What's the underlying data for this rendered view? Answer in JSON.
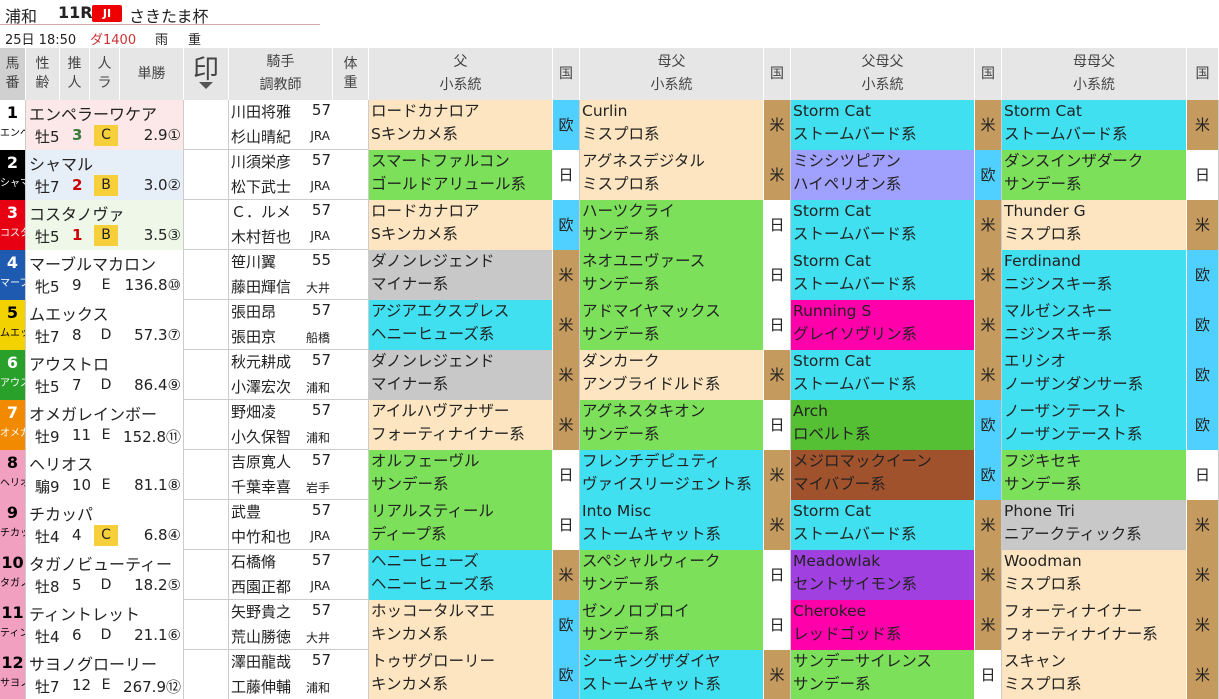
{
  "race": {
    "venue": "浦和",
    "race_no": "11R",
    "grade": "JⅠ",
    "name": "さきたま杯",
    "time": "25日 18:50",
    "course": "ダ1400",
    "weather": "雨",
    "track": "重"
  },
  "headers": {
    "num": "馬番",
    "sex_age": "性齢",
    "pop": "推人",
    "eval": "人ラ",
    "odds": "単勝",
    "mark": "印",
    "jockey_trainer": [
      "騎手",
      "調教師"
    ],
    "weight": "体重",
    "sire": [
      "父",
      "小系統"
    ],
    "country": "国",
    "dam_sire": [
      "母父",
      "小系統"
    ],
    "sire_dam_sire": [
      "父母父",
      "小系統"
    ],
    "dam_dam_sire": [
      "母母父",
      "小系統"
    ]
  },
  "colors": {
    "gate": [
      "#ffffff",
      "#000000",
      "#e60012",
      "#1e5bb0",
      "#f2d200",
      "#28a02a",
      "#f28a00",
      "#f2a0c0"
    ],
    "lineage": {
      "kingkame": "#fce5c0",
      "sunday": "#7ce05a",
      "nasrullah": "#40e0f0",
      "northern": "#40e0f0",
      "native": "#40e0f0",
      "mrprospector": "#fce5c0",
      "hail": "#d0d0d0",
      "nijinsky": "#40e0f0",
      "other": "#ff00aa",
      "hyperion": "#a0a0ff",
      "roberto": "#55c033",
      "maibabu": "#a0522d",
      "fairway": "#a040e0",
      "redgod": "#ff00aa"
    },
    "country": {
      "欧": "#4fd0ff",
      "日": "#ffffff",
      "米": "#c49a5e"
    }
  },
  "rows": [
    {
      "no": "1",
      "abbr": "エンペ",
      "gate": 0,
      "horse": "エンペラーワケア",
      "sex_age": "牡5",
      "pop": "3",
      "pop_style": "g",
      "eval": "C",
      "eval_box": true,
      "odds": "2.9①",
      "jockey": "川田将雅",
      "weight": "57",
      "trainer": "杉山晴紀",
      "aff": "JRA",
      "row_bg": "#fce8e8",
      "sire": [
        "ロードカナロア",
        "Sキンカメ系"
      ],
      "sire_c": "#fce5c0",
      "sire_n": "欧",
      "sire_nc": "#4fd0ff",
      "dams": [
        "Curlin",
        "ミスプロ系"
      ],
      "dams_c": "#fce5c0",
      "dams_n": "米",
      "dams_nc": "#c49a5e",
      "sds": [
        "Storm Cat",
        "ストームバード系"
      ],
      "sds_c": "#40e0f0",
      "sds_n": "米",
      "sds_nc": "#c49a5e",
      "dds": [
        "Storm Cat",
        "ストームバード系"
      ],
      "dds_c": "#40e0f0",
      "dds_n": "米",
      "dds_nc": "#c49a5e"
    },
    {
      "no": "2",
      "abbr": "シャマ",
      "gate": 1,
      "horse": "シャマル",
      "sex_age": "牡7",
      "pop": "2",
      "pop_style": "hi",
      "eval": "B",
      "eval_box": true,
      "odds": "3.0②",
      "jockey": "川須栄彦",
      "weight": "57",
      "trainer": "松下武士",
      "aff": "JRA",
      "row_bg": "#e6eef8",
      "sire": [
        "スマートファルコン",
        "ゴールドアリュール系"
      ],
      "sire_c": "#7ce05a",
      "sire_n": "日",
      "sire_nc": "#ffffff",
      "dams": [
        "アグネスデジタル",
        "ミスプロ系"
      ],
      "dams_c": "#fce5c0",
      "dams_n": "米",
      "dams_nc": "#c49a5e",
      "sds": [
        "ミシシツピアン",
        "ハイペリオン系"
      ],
      "sds_c": "#a0a0ff",
      "sds_n": "欧",
      "sds_nc": "#4fd0ff",
      "dds": [
        "ダンスインザダーク",
        "サンデー系"
      ],
      "dds_c": "#7ce05a",
      "dds_n": "日",
      "dds_nc": "#ffffff"
    },
    {
      "no": "3",
      "abbr": "コスタ",
      "gate": 2,
      "horse": "コスタノヴァ",
      "sex_age": "牡5",
      "pop": "1",
      "pop_style": "hi",
      "eval": "B",
      "eval_box": true,
      "odds": "3.5③",
      "jockey": "Ｃ．ルメ",
      "weight": "57",
      "trainer": "木村哲也",
      "aff": "JRA",
      "row_bg": "#eef7e8",
      "sire": [
        "ロードカナロア",
        "Sキンカメ系"
      ],
      "sire_c": "#fce5c0",
      "sire_n": "欧",
      "sire_nc": "#4fd0ff",
      "dams": [
        "ハーツクライ",
        "サンデー系"
      ],
      "dams_c": "#7ce05a",
      "dams_n": "日",
      "dams_nc": "#ffffff",
      "sds": [
        "Storm Cat",
        "ストームバード系"
      ],
      "sds_c": "#40e0f0",
      "sds_n": "米",
      "sds_nc": "#c49a5e",
      "dds": [
        "Thunder G",
        "ミスプロ系"
      ],
      "dds_c": "#fce5c0",
      "dds_n": "米",
      "dds_nc": "#c49a5e"
    },
    {
      "no": "4",
      "abbr": "マーブ",
      "gate": 3,
      "horse": "マーブルマカロン",
      "sex_age": "牝5",
      "pop": "9",
      "pop_style": "",
      "eval": "E",
      "eval_box": false,
      "odds": "136.8⑩",
      "jockey": "笹川翼",
      "weight": "55",
      "trainer": "藤田輝信",
      "aff": "大井",
      "row_bg": "#ffffff",
      "sire": [
        "ダノンレジェンド",
        "マイナー系"
      ],
      "sire_c": "#c8c8c8",
      "sire_n": "米",
      "sire_nc": "#c49a5e",
      "dams": [
        "ネオユニヴァース",
        "サンデー系"
      ],
      "dams_c": "#7ce05a",
      "dams_n": "日",
      "dams_nc": "#ffffff",
      "sds": [
        "Storm Cat",
        "ストームバード系"
      ],
      "sds_c": "#40e0f0",
      "sds_n": "米",
      "sds_nc": "#c49a5e",
      "dds": [
        "Ferdinand",
        "ニジンスキー系"
      ],
      "dds_c": "#40e0f0",
      "dds_n": "欧",
      "dds_nc": "#4fd0ff"
    },
    {
      "no": "5",
      "abbr": "ムエッ",
      "gate": 4,
      "horse": "ムエックス",
      "sex_age": "牡7",
      "pop": "8",
      "pop_style": "",
      "eval": "D",
      "eval_box": false,
      "odds": "57.3⑦",
      "jockey": "張田昂",
      "weight": "57",
      "trainer": "張田京",
      "aff": "船橋",
      "row_bg": "#ffffff",
      "sire": [
        "アジアエクスプレス",
        "ヘニーヒューズ系"
      ],
      "sire_c": "#40e0f0",
      "sire_n": "米",
      "sire_nc": "#c49a5e",
      "dams": [
        "アドマイヤマックス",
        "サンデー系"
      ],
      "dams_c": "#7ce05a",
      "dams_n": "日",
      "dams_nc": "#ffffff",
      "sds": [
        "Running S",
        "グレイソヴリン系"
      ],
      "sds_c": "#ff00aa",
      "sds_n": "米",
      "sds_nc": "#c49a5e",
      "dds": [
        "マルゼンスキー",
        "ニジンスキー系"
      ],
      "dds_c": "#40e0f0",
      "dds_n": "欧",
      "dds_nc": "#4fd0ff"
    },
    {
      "no": "6",
      "abbr": "アウス",
      "gate": 5,
      "horse": "アウストロ",
      "sex_age": "牡5",
      "pop": "7",
      "pop_style": "",
      "eval": "D",
      "eval_box": false,
      "odds": "86.4⑨",
      "jockey": "秋元耕成",
      "weight": "57",
      "trainer": "小澤宏次",
      "aff": "浦和",
      "row_bg": "#ffffff",
      "sire": [
        "ダノンレジェンド",
        "マイナー系"
      ],
      "sire_c": "#c8c8c8",
      "sire_n": "米",
      "sire_nc": "#c49a5e",
      "dams": [
        "ダンカーク",
        "アンブライドルド系"
      ],
      "dams_c": "#fce5c0",
      "dams_n": "米",
      "dams_nc": "#c49a5e",
      "sds": [
        "Storm Cat",
        "ストームバード系"
      ],
      "sds_c": "#40e0f0",
      "sds_n": "米",
      "sds_nc": "#c49a5e",
      "dds": [
        "エリシオ",
        "ノーザンダンサー系"
      ],
      "dds_c": "#40e0f0",
      "dds_n": "欧",
      "dds_nc": "#4fd0ff"
    },
    {
      "no": "7",
      "abbr": "オメガ",
      "gate": 6,
      "horse": "オメガレインボー",
      "sex_age": "牡9",
      "pop": "11",
      "pop_style": "",
      "eval": "E",
      "eval_box": false,
      "odds": "152.8⑪",
      "jockey": "野畑凌",
      "weight": "57",
      "trainer": "小久保智",
      "aff": "浦和",
      "row_bg": "#ffffff",
      "sire": [
        "アイルハヴアナザー",
        "フォーティナイナー系"
      ],
      "sire_c": "#fce5c0",
      "sire_n": "米",
      "sire_nc": "#c49a5e",
      "dams": [
        "アグネスタキオン",
        "サンデー系"
      ],
      "dams_c": "#7ce05a",
      "dams_n": "日",
      "dams_nc": "#ffffff",
      "sds": [
        "Arch",
        "ロベルト系"
      ],
      "sds_c": "#55c033",
      "sds_n": "欧",
      "sds_nc": "#4fd0ff",
      "dds": [
        "ノーザンテースト",
        "ノーザンテースト系"
      ],
      "dds_c": "#40e0f0",
      "dds_n": "欧",
      "dds_nc": "#4fd0ff"
    },
    {
      "no": "8",
      "abbr": "ヘリオ",
      "gate": 7,
      "horse": "ヘリオス",
      "sex_age": "騸9",
      "pop": "10",
      "pop_style": "",
      "eval": "E",
      "eval_box": false,
      "odds": "81.1⑧",
      "jockey": "吉原寛人",
      "weight": "57",
      "trainer": "千葉幸喜",
      "aff": "岩手",
      "row_bg": "#ffffff",
      "sire": [
        "オルフェーヴル",
        "サンデー系"
      ],
      "sire_c": "#7ce05a",
      "sire_n": "日",
      "sire_nc": "#ffffff",
      "dams": [
        "フレンチデピュティ",
        "ヴァイスリージェント系"
      ],
      "dams_c": "#40e0f0",
      "dams_n": "米",
      "dams_nc": "#c49a5e",
      "sds": [
        "メジロマックイーン",
        "マイバブー系"
      ],
      "sds_c": "#a0522d",
      "sds_n": "欧",
      "sds_nc": "#4fd0ff",
      "dds": [
        "フジキセキ",
        "サンデー系"
      ],
      "dds_c": "#7ce05a",
      "dds_n": "日",
      "dds_nc": "#ffffff"
    },
    {
      "no": "9",
      "abbr": "チカッ",
      "gate": 7,
      "horse": "チカッパ",
      "sex_age": "牡4",
      "pop": "4",
      "pop_style": "",
      "eval": "C",
      "eval_box": true,
      "odds": "6.8④",
      "jockey": "武豊",
      "weight": "57",
      "trainer": "中竹和也",
      "aff": "JRA",
      "row_bg": "#ffffff",
      "sire": [
        "リアルスティール",
        "ディープ系"
      ],
      "sire_c": "#7ce05a",
      "sire_n": "日",
      "sire_nc": "#ffffff",
      "dams": [
        "Into Misc",
        "ストームキャット系"
      ],
      "dams_c": "#40e0f0",
      "dams_n": "米",
      "dams_nc": "#c49a5e",
      "sds": [
        "Storm Cat",
        "ストームバード系"
      ],
      "sds_c": "#40e0f0",
      "sds_n": "米",
      "sds_nc": "#c49a5e",
      "dds": [
        "Phone Tri",
        "ニアークティック系"
      ],
      "dds_c": "#c8c8c8",
      "dds_n": "米",
      "dds_nc": "#c49a5e"
    },
    {
      "no": "10",
      "abbr": "タガノ",
      "gate": 7,
      "horse": "タガノビューティー",
      "sex_age": "牡8",
      "pop": "5",
      "pop_style": "",
      "eval": "D",
      "eval_box": false,
      "odds": "18.2⑤",
      "jockey": "石橋脩",
      "weight": "57",
      "trainer": "西園正都",
      "aff": "JRA",
      "row_bg": "#ffffff",
      "sire": [
        "ヘニーヒューズ",
        "ヘニーヒューズ系"
      ],
      "sire_c": "#40e0f0",
      "sire_n": "米",
      "sire_nc": "#c49a5e",
      "dams": [
        "スペシャルウィーク",
        "サンデー系"
      ],
      "dams_c": "#7ce05a",
      "dams_n": "日",
      "dams_nc": "#ffffff",
      "sds": [
        "Meadowlak",
        "セントサイモン系"
      ],
      "sds_c": "#a040e0",
      "sds_n": "米",
      "sds_nc": "#c49a5e",
      "dds": [
        "Woodman",
        "ミスプロ系"
      ],
      "dds_c": "#fce5c0",
      "dds_n": "米",
      "dds_nc": "#c49a5e"
    },
    {
      "no": "11",
      "abbr": "ティン",
      "gate": 7,
      "horse": "ティントレット",
      "sex_age": "牡4",
      "pop": "6",
      "pop_style": "",
      "eval": "D",
      "eval_box": false,
      "odds": "21.1⑥",
      "jockey": "矢野貴之",
      "weight": "57",
      "trainer": "荒山勝徳",
      "aff": "大井",
      "row_bg": "#ffffff",
      "sire": [
        "ホッコータルマエ",
        "キンカメ系"
      ],
      "sire_c": "#fce5c0",
      "sire_n": "欧",
      "sire_nc": "#4fd0ff",
      "dams": [
        "ゼンノロブロイ",
        "サンデー系"
      ],
      "dams_c": "#7ce05a",
      "dams_n": "日",
      "dams_nc": "#ffffff",
      "sds": [
        "Cherokee",
        "レッドゴッド系"
      ],
      "sds_c": "#ff00aa",
      "sds_n": "米",
      "sds_nc": "#c49a5e",
      "dds": [
        "フォーティナイナー",
        "フォーティナイナー系"
      ],
      "dds_c": "#fce5c0",
      "dds_n": "米",
      "dds_nc": "#c49a5e"
    },
    {
      "no": "12",
      "abbr": "サヨノ",
      "gate": 7,
      "horse": "サヨノグローリー",
      "sex_age": "牡7",
      "pop": "12",
      "pop_style": "",
      "eval": "E",
      "eval_box": false,
      "odds": "267.9⑫",
      "jockey": "澤田龍哉",
      "weight": "57",
      "trainer": "工藤伸輔",
      "aff": "浦和",
      "row_bg": "#ffffff",
      "sire": [
        "トゥザグローリー",
        "キンカメ系"
      ],
      "sire_c": "#fce5c0",
      "sire_n": "欧",
      "sire_nc": "#4fd0ff",
      "dams": [
        "シーキングザダイヤ",
        "ストームキャット系"
      ],
      "dams_c": "#40e0f0",
      "dams_n": "米",
      "dams_nc": "#c49a5e",
      "sds": [
        "サンデーサイレンス",
        "サンデー系"
      ],
      "sds_c": "#7ce05a",
      "sds_n": "日",
      "sds_nc": "#ffffff",
      "dds": [
        "スキャン",
        "ミスプロ系"
      ],
      "dds_c": "#fce5c0",
      "dds_n": "米",
      "dds_nc": "#c49a5e"
    }
  ]
}
